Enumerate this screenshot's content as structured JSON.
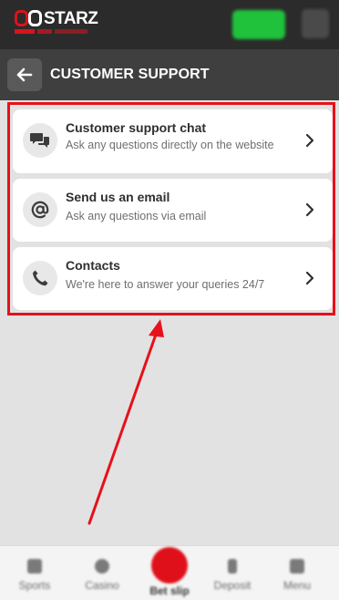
{
  "header": {
    "logo_text_left": "8",
    "logo_text_main": "STARZ",
    "login_label": "",
    "menu_label": ""
  },
  "title_bar": {
    "title": "CUSTOMER SUPPORT"
  },
  "support": {
    "items": [
      {
        "title": "Customer support chat",
        "description": "Ask any questions directly on the website",
        "icon": "chat-icon"
      },
      {
        "title": "Send us an email",
        "description": "Ask any questions via email",
        "icon": "at-icon"
      },
      {
        "title": "Contacts",
        "description": "We're here to answer your queries 24/7",
        "icon": "phone-icon"
      }
    ]
  },
  "bottom_nav": {
    "items": [
      {
        "label": "Sports",
        "icon": "trophy-icon"
      },
      {
        "label": "Casino",
        "icon": "chip-icon"
      },
      {
        "label": "Bet slip",
        "icon": "ticket-icon"
      },
      {
        "label": "Deposit",
        "icon": "dollar-icon"
      },
      {
        "label": "Menu",
        "icon": "grid-icon"
      }
    ]
  },
  "colors": {
    "header_bg": "#2b2b2b",
    "title_bar_bg": "#3f3f3f",
    "accent_red": "#e8101a",
    "login_green": "#1fc23a",
    "page_bg": "#e2e2e2"
  }
}
